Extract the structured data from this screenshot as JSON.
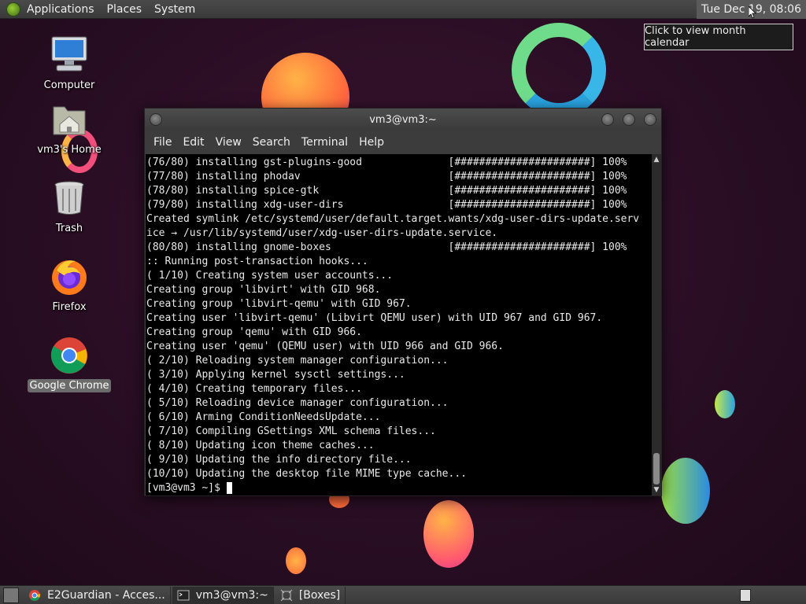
{
  "top_panel": {
    "menus": [
      "Applications",
      "Places",
      "System"
    ],
    "clock": "Tue Dec 19, 08:06",
    "clock_tooltip": "Click to view month calendar"
  },
  "desktop_icons": [
    {
      "label": "Computer",
      "icon": "computer-icon"
    },
    {
      "label": "vm3's Home",
      "icon": "home-folder-icon"
    },
    {
      "label": "Trash",
      "icon": "trash-icon"
    },
    {
      "label": "Firefox",
      "icon": "firefox-icon"
    },
    {
      "label": "Google Chrome",
      "icon": "chrome-icon",
      "selected": true
    }
  ],
  "terminal_window": {
    "title": "vm3@vm3:~",
    "menu": [
      "File",
      "Edit",
      "View",
      "Search",
      "Terminal",
      "Help"
    ],
    "lines": [
      "(76/80) installing gst-plugins-good              [######################] 100%",
      "(77/80) installing phodav                        [######################] 100%",
      "(78/80) installing spice-gtk                     [######################] 100%",
      "(79/80) installing xdg-user-dirs                 [######################] 100%",
      "Created symlink /etc/systemd/user/default.target.wants/xdg-user-dirs-update.serv",
      "ice → /usr/lib/systemd/user/xdg-user-dirs-update.service.",
      "(80/80) installing gnome-boxes                   [######################] 100%",
      ":: Running post-transaction hooks...",
      "( 1/10) Creating system user accounts...",
      "Creating group 'libvirt' with GID 968.",
      "Creating group 'libvirt-qemu' with GID 967.",
      "Creating user 'libvirt-qemu' (Libvirt QEMU user) with UID 967 and GID 967.",
      "Creating group 'qemu' with GID 966.",
      "Creating user 'qemu' (QEMU user) with UID 966 and GID 966.",
      "( 2/10) Reloading system manager configuration...",
      "( 3/10) Applying kernel sysctl settings...",
      "( 4/10) Creating temporary files...",
      "( 5/10) Reloading device manager configuration...",
      "( 6/10) Arming ConditionNeedsUpdate...",
      "( 7/10) Compiling GSettings XML schema files...",
      "( 8/10) Updating icon theme caches...",
      "( 9/10) Updating the info directory file...",
      "(10/10) Updating the desktop file MIME type cache..."
    ],
    "prompt": "[vm3@vm3 ~]$ "
  },
  "taskbar": {
    "tasks": [
      {
        "label": "E2Guardian - Acces...",
        "icon": "chrome-icon",
        "active": false
      },
      {
        "label": "vm3@vm3:~",
        "icon": "terminal-icon",
        "active": true
      },
      {
        "label": "[Boxes]",
        "icon": "boxes-icon",
        "active": false
      }
    ]
  },
  "colors": {
    "desktop_bg": "#2a0e22",
    "panel_bg": "#3f3f3f",
    "terminal_bg": "#000000",
    "terminal_fg": "#e8e8e8"
  }
}
